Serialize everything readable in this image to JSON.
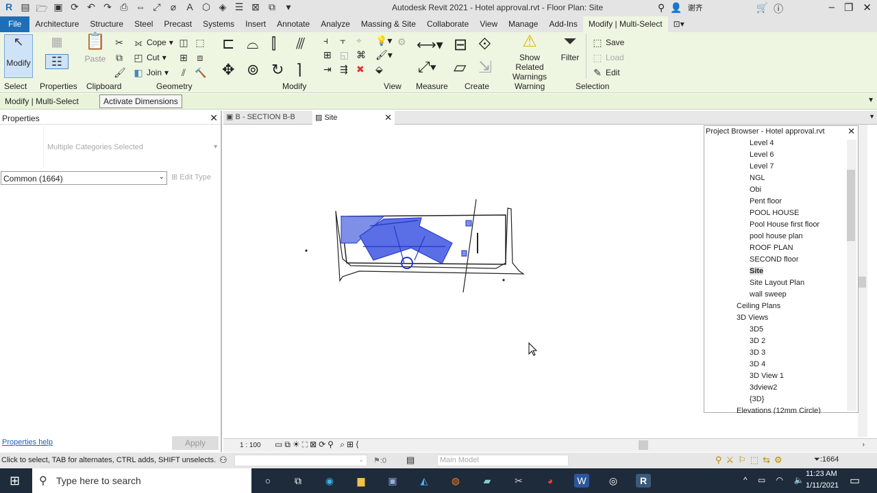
{
  "app": {
    "title": "Autodesk Revit 2021 - Hotel  approval.rvt - Floor Plan: Site",
    "user": "谢齐"
  },
  "tabs": [
    "File",
    "Architecture",
    "Structure",
    "Steel",
    "Precast",
    "Systems",
    "Insert",
    "Annotate",
    "Analyze",
    "Massing & Site",
    "Collaborate",
    "View",
    "Manage",
    "Add-Ins",
    "Modify | Multi-Select"
  ],
  "ribbon": {
    "modify": "Modify",
    "select": "Select",
    "properties": "Properties",
    "paste": "Paste",
    "clipboard": "Clipboard",
    "cope": "Cope",
    "cut": "Cut",
    "join": "Join",
    "geometry": "Geometry",
    "modify_panel": "Modify",
    "view": "View",
    "measure": "Measure",
    "create": "Create",
    "show_related_warnings": "Show Related Warnings",
    "warning": "Warning",
    "filter": "Filter",
    "save": "Save",
    "load": "Load",
    "edit": "Edit",
    "selection": "Selection"
  },
  "optbar": {
    "context": "Modify | Multi-Select",
    "activate_dimensions": "Activate Dimensions"
  },
  "properties": {
    "title": "Properties",
    "type_selector": "Multiple Categories Selected",
    "filter": "Common (1664)",
    "edit_type": "Edit Type",
    "help": "Properties help",
    "apply": "Apply"
  },
  "view_tabs": [
    {
      "label": "B - SECTION B-B"
    },
    {
      "label": "Site"
    }
  ],
  "project_browser": {
    "title": "Project Browser - Hotel  approval.rvt",
    "floor_plans": [
      "Level 4",
      "Level 6",
      "Level 7",
      "NGL",
      "Obi",
      "Pent floor",
      "POOL HOUSE",
      "Pool House first floor",
      "pool house plan",
      "ROOF PLAN",
      "SECOND floor",
      "Site",
      "Site Layout Plan",
      "wall sweep"
    ],
    "ceiling_plans": "Ceiling Plans",
    "views_3d": "3D Views",
    "views_3d_items": [
      "3D5",
      "3D 2",
      "3D 3",
      "3D 4",
      "3D View 1",
      "3dview2",
      "{3D}"
    ],
    "elevations": "Elevations (12mm Circle)"
  },
  "view_control": {
    "scale": "1 : 100"
  },
  "status": {
    "hint": "Click to select, TAB for alternates, CTRL adds, SHIFT unselects.",
    "zero": ":0",
    "workset": "Main Model",
    "selection_count": ":1664"
  },
  "taskbar": {
    "search": "Type here to search",
    "time": "11:23 AM",
    "date": "1/11/2021"
  }
}
